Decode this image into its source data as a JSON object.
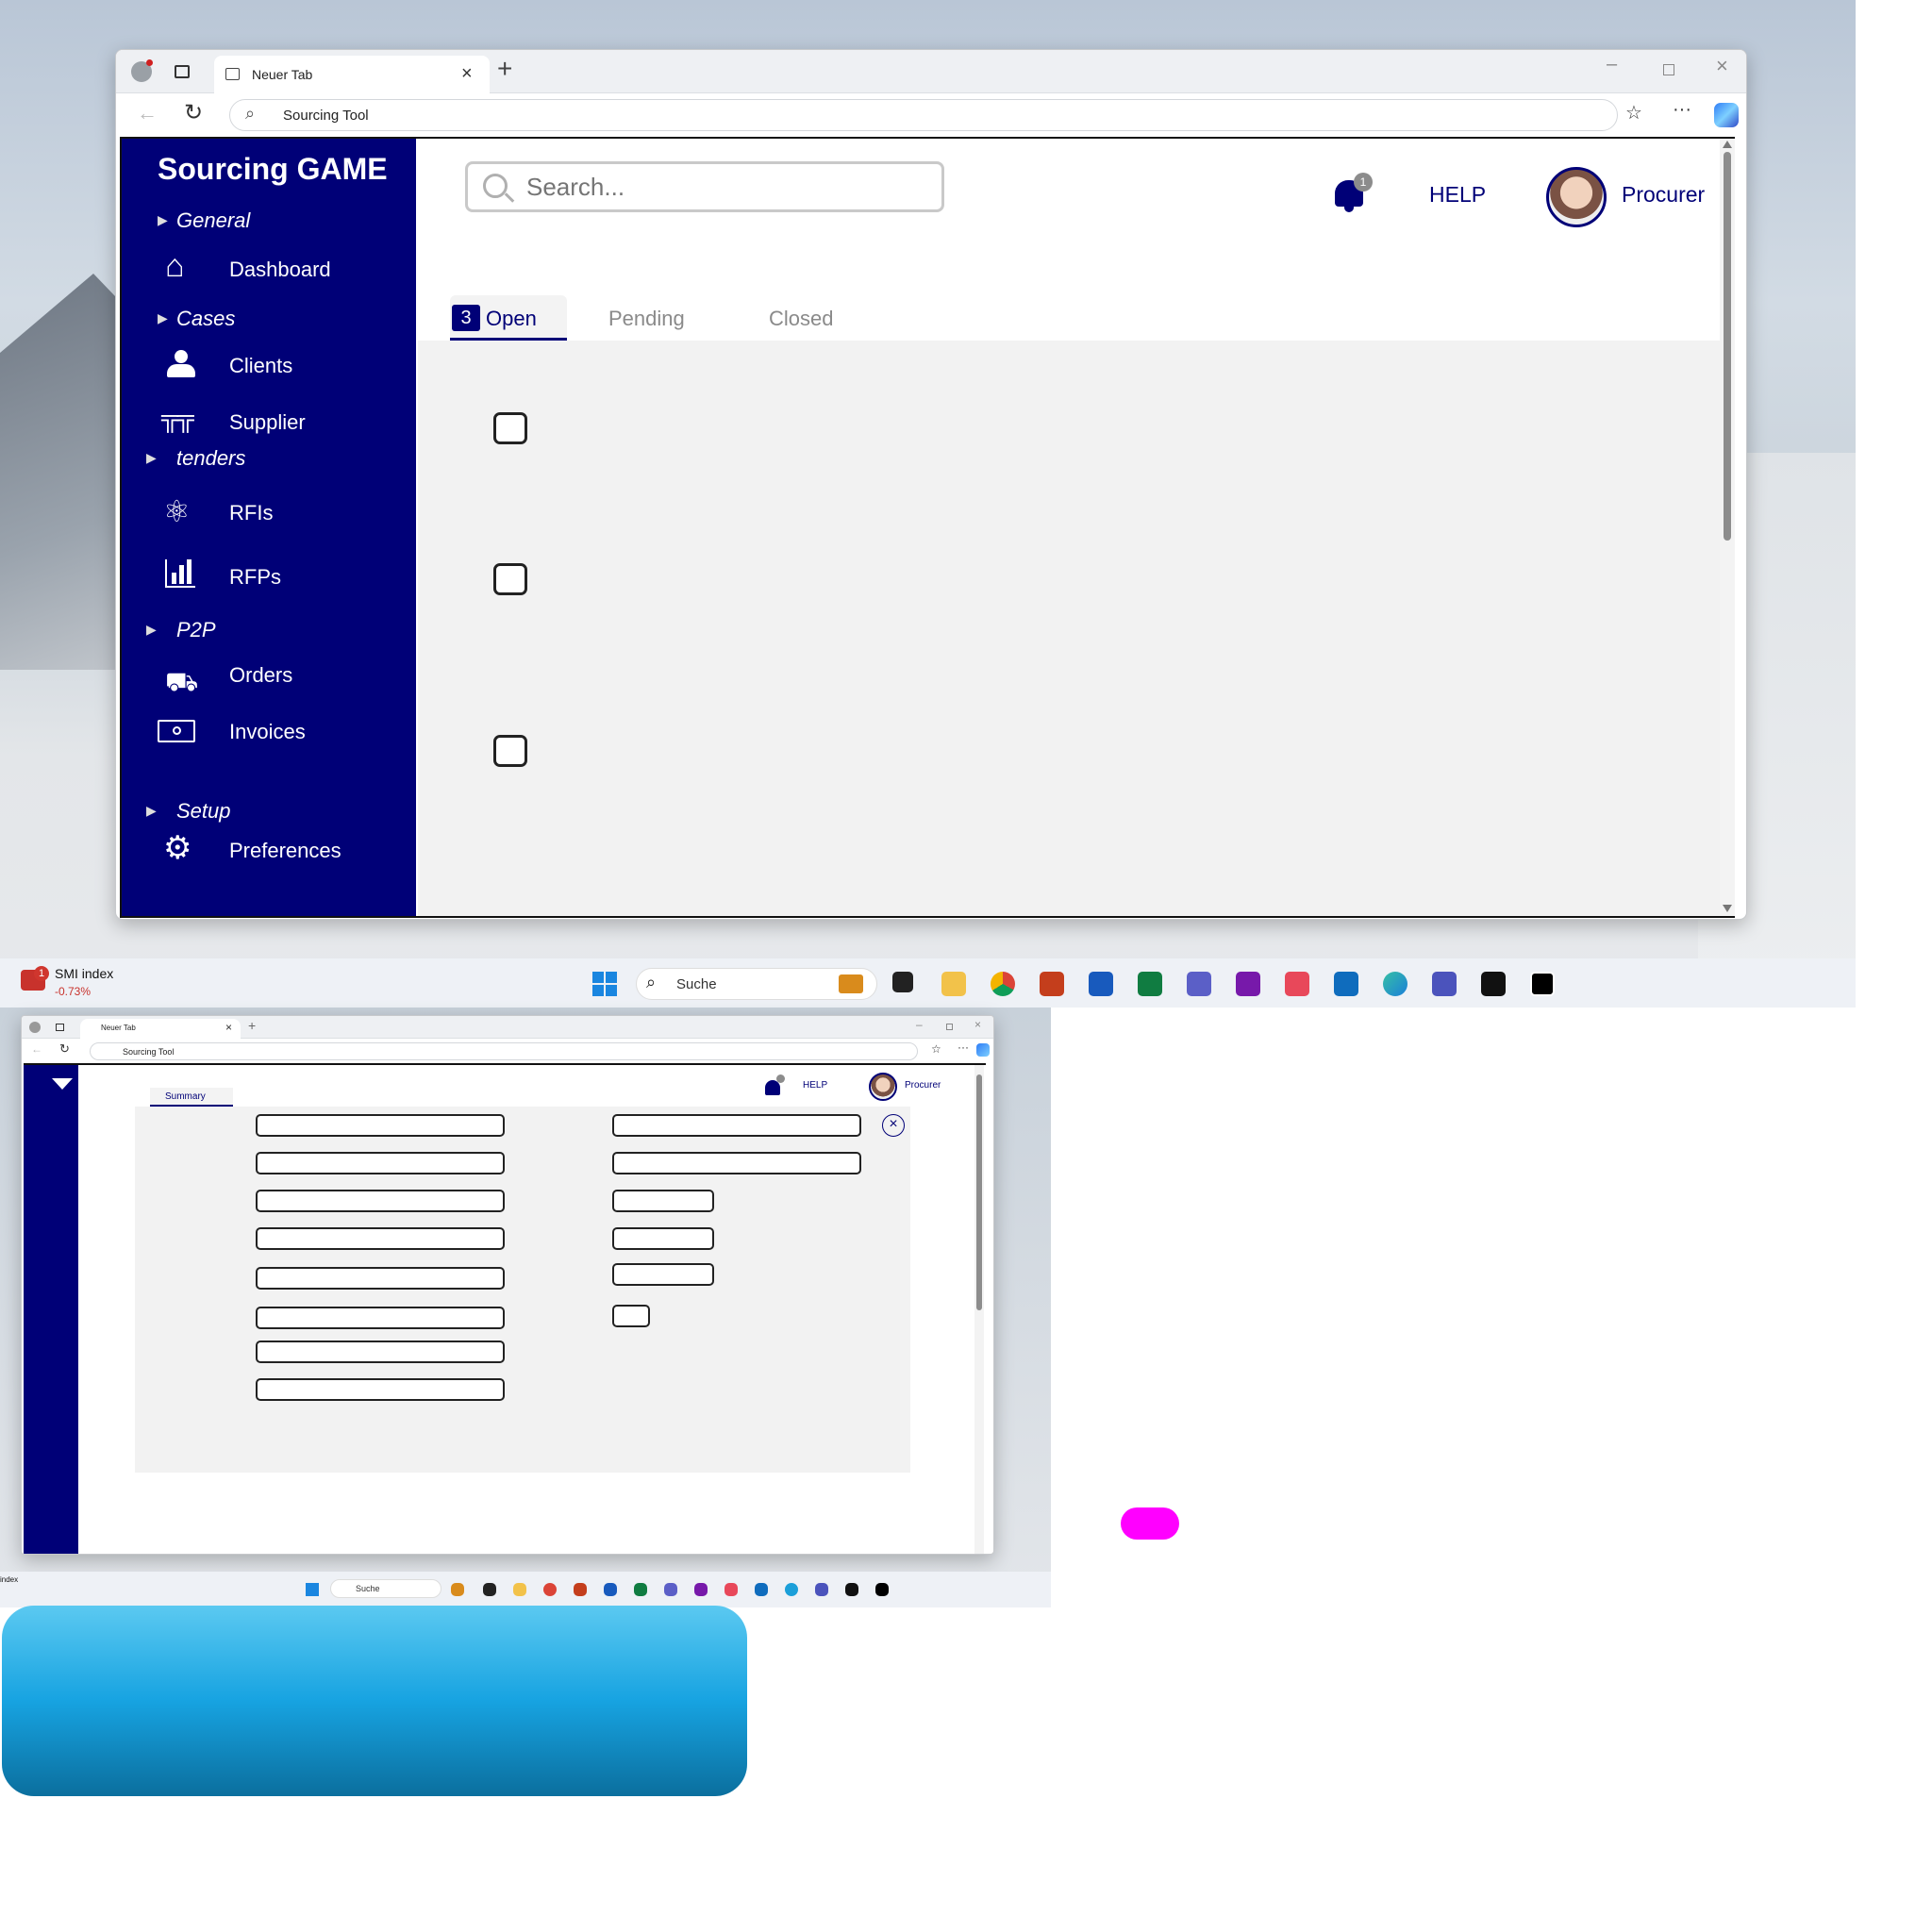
{
  "browser": {
    "tab_title": "Neuer Tab",
    "address": "Sourcing Tool"
  },
  "app": {
    "brand": "Sourcing GAME",
    "search_placeholder": "Search...",
    "notification_count": "1",
    "help": "HELP",
    "user": "Procurer",
    "sections": {
      "general": "General",
      "cases": "Cases",
      "tenders": "tenders",
      "p2p": "P2P",
      "setup": "Setup"
    },
    "items": {
      "dashboard": "Dashboard",
      "clients": "Clients",
      "supplier": "Supplier",
      "rfis": "RFIs",
      "rfps": "RFPs",
      "orders": "Orders",
      "invoices": "Invoices",
      "preferences": "Preferences"
    },
    "tabs": {
      "open_count": "3",
      "open": "Open",
      "pending": "Pending",
      "closed": "Closed"
    }
  },
  "taskbar": {
    "widget_title": "SMI index",
    "widget_value": "-0.73%",
    "widget_badge": "1",
    "search": "Suche"
  },
  "mini": {
    "tab_title": "Neuer Tab",
    "address": "Sourcing Tool",
    "help": "HELP",
    "user": "Procurer",
    "summary_tab": "Summary",
    "taskbar_search": "Suche",
    "widget_title": "index"
  },
  "colors": {
    "sidebar": "#000077",
    "accent": "#000077",
    "content_bg": "#f2f2f2"
  }
}
